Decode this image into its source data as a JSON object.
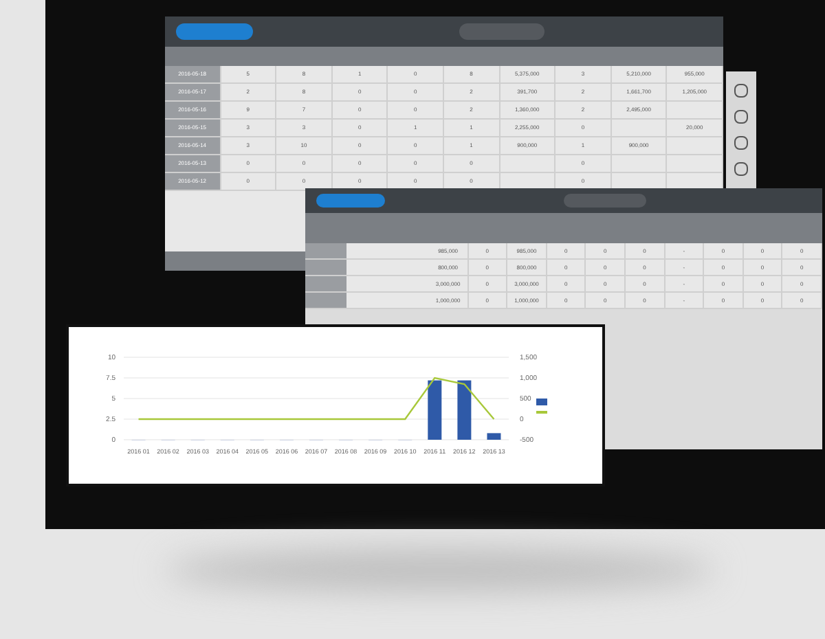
{
  "sales_window": {
    "rows": [
      [
        "2016-05-18",
        "5",
        "8",
        "1",
        "0",
        "8",
        "5,375,000",
        "3",
        "5,210,000",
        "955,000"
      ],
      [
        "2016-05-17",
        "2",
        "8",
        "0",
        "0",
        "2",
        "391,700",
        "2",
        "1,661,700",
        "1,205,000"
      ],
      [
        "2016-05-16",
        "9",
        "7",
        "0",
        "0",
        "2",
        "1,360,000",
        "2",
        "2,495,000",
        null
      ],
      [
        "2016-05-15",
        "3",
        "3",
        "0",
        "1",
        "1",
        "2,255,000",
        "0",
        null,
        "20,000"
      ],
      [
        "2016-05-14",
        "3",
        "10",
        "0",
        "0",
        "1",
        "900,000",
        "1",
        "900,000",
        null
      ],
      [
        "2016-05-13",
        "0",
        "0",
        "0",
        "0",
        "0",
        null,
        "0",
        null,
        null
      ],
      [
        "2016-05-12",
        "0",
        "0",
        "0",
        "0",
        "0",
        null,
        "0",
        null,
        null
      ]
    ]
  },
  "detail_window": {
    "rows": [
      [
        "985,000",
        "0",
        "985,000",
        "0",
        "0",
        "0",
        "-",
        "0",
        "0",
        "0"
      ],
      [
        "800,000",
        "0",
        "800,000",
        "0",
        "0",
        "0",
        "-",
        "0",
        "0",
        "0"
      ],
      [
        "3,000,000",
        "0",
        "3,000,000",
        "0",
        "0",
        "0",
        "-",
        "0",
        "0",
        "0"
      ],
      [
        "1,000,000",
        "0",
        "1,000,000",
        "0",
        "0",
        "0",
        "-",
        "0",
        "0",
        "0"
      ]
    ]
  },
  "chart_window": {
    "chart_data": {
      "type": "bar",
      "categories": [
        "2016 01",
        "2016 02",
        "2016 03",
        "2016 04",
        "2016 05",
        "2016 06",
        "2016 07",
        "2016 08",
        "2016 09",
        "2016 10",
        "2016 11",
        "2016 12",
        "2016 13"
      ],
      "grid": true,
      "ylim": [
        0,
        10
      ],
      "y2lim": [
        -500,
        1500
      ],
      "series": [
        {
          "type": "bar",
          "color": "#2f5aa8",
          "values": [
            0,
            0,
            0,
            0,
            0,
            0,
            0,
            0,
            0,
            0,
            7.2,
            7.2,
            0.8
          ]
        },
        {
          "type": "line",
          "axis": "y2",
          "color": "#a8c83a",
          "values": [
            0,
            0,
            0,
            0,
            0,
            0,
            0,
            0,
            0,
            0,
            1000,
            850,
            0
          ]
        }
      ],
      "yticks": [
        0,
        2.5,
        5,
        7.5,
        10
      ],
      "y2ticks": [
        {
          "value": -500,
          "label": "-500"
        },
        {
          "value": 0,
          "label": "0"
        },
        {
          "value": 500,
          "label": "500"
        },
        {
          "value": 1000,
          "label": "1,000"
        },
        {
          "value": 1500,
          "label": "1,500"
        }
      ]
    }
  }
}
